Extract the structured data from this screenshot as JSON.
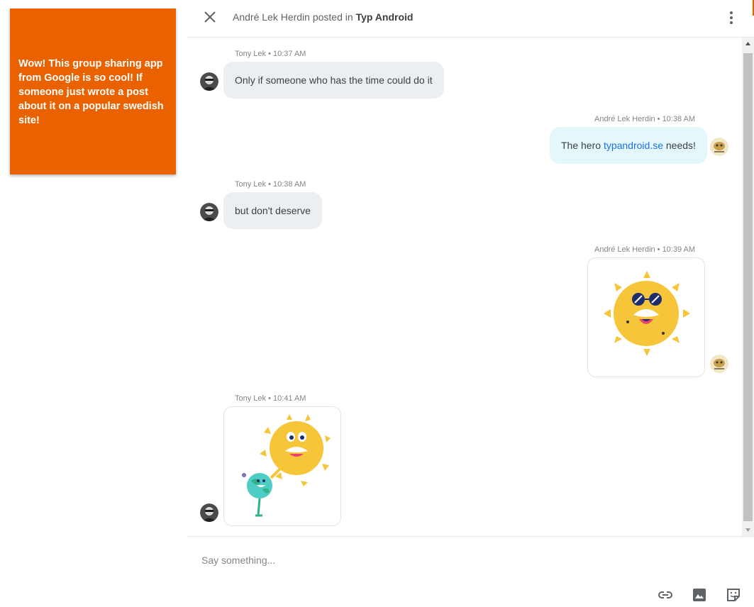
{
  "post_card": {
    "text": "Wow! This group sharing app from Google is so cool! If someone just wrote a post about it on a popular swedish site!",
    "color": "#ea6100"
  },
  "header": {
    "author": "André Lek Herdin",
    "posted_in_text": "posted in",
    "group": "Typ Android",
    "close_icon": "close-icon",
    "menu_icon": "more-vert-icon"
  },
  "messages": [
    {
      "sender_meta": "Tony Lek • 10:37 AM",
      "text": "Only if someone who has the time could do it",
      "direction": "incoming"
    },
    {
      "sender_meta": "André Lek Herdin • 10:38 AM",
      "text_before": "The hero ",
      "link": "typandroid.se",
      "text_after": " needs!",
      "direction": "outgoing"
    },
    {
      "sender_meta": "Tony Lek • 10:38 AM",
      "text": "but don't deserve",
      "direction": "incoming"
    },
    {
      "sender_meta": "André Lek Herdin • 10:39 AM",
      "sticker": "sun-sunglasses-sticker",
      "direction": "outgoing"
    },
    {
      "sender_meta": "Tony Lek • 10:41 AM",
      "sticker": "sun-and-earth-sticker",
      "direction": "incoming"
    }
  ],
  "composer": {
    "placeholder": "Say something...",
    "tools": [
      "link-icon",
      "image-icon",
      "sticker-icon"
    ]
  },
  "colors": {
    "accent": "#ea6100",
    "incoming_bubble": "#eceff1",
    "outgoing_bubble": "#e4f7fb",
    "link": "#1a73e8"
  }
}
